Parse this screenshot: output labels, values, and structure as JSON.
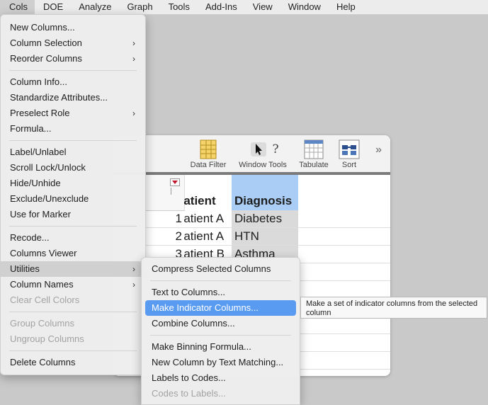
{
  "menubar": [
    "Cols",
    "DOE",
    "Analyze",
    "Graph",
    "Tools",
    "Add-Ins",
    "View",
    "Window",
    "Help"
  ],
  "toolbar": {
    "data_filter": "Data Filter",
    "window_tools": "Window Tools",
    "tabulate": "Tabulate",
    "sort": "Sort"
  },
  "table": {
    "columns": [
      "Patient",
      "Diagnosis"
    ],
    "rows": [
      {
        "num": "1",
        "patient": "Patient A",
        "diagnosis": "Diabetes"
      },
      {
        "num": "2",
        "patient": "Patient A",
        "diagnosis": "HTN"
      },
      {
        "num": "3",
        "patient": "Patient B",
        "diagnosis": "Asthma"
      }
    ]
  },
  "cols_menu": {
    "new_columns": "New Columns...",
    "column_selection": "Column Selection",
    "reorder_columns": "Reorder Columns",
    "column_info": "Column Info...",
    "standardize_attributes": "Standardize Attributes...",
    "preselect_role": "Preselect Role",
    "formula": "Formula...",
    "label_unlabel": "Label/Unlabel",
    "scroll_lock": "Scroll Lock/Unlock",
    "hide_unhide": "Hide/Unhide",
    "exclude_unexclude": "Exclude/Unexclude",
    "use_for_marker": "Use for Marker",
    "recode": "Recode...",
    "columns_viewer": "Columns Viewer",
    "utilities": "Utilities",
    "column_names": "Column Names",
    "clear_cell_colors": "Clear Cell Colors",
    "group_columns": "Group Columns",
    "ungroup_columns": "Ungroup Columns",
    "delete_columns": "Delete Columns"
  },
  "utilities_menu": {
    "compress_selected": "Compress Selected Columns",
    "text_to_columns": "Text to Columns...",
    "make_indicator": "Make Indicator Columns...",
    "combine_columns": "Combine Columns...",
    "make_binning": "Make Binning Formula...",
    "new_column_text_matching": "New Column by Text Matching...",
    "labels_to_codes": "Labels to Codes...",
    "codes_to_labels": "Codes to Labels..."
  },
  "tooltip": "Make a set of indicator columns from the selected column",
  "colors": {
    "highlight": "#5a9bf2",
    "selected_column": "#a9cdf5"
  }
}
